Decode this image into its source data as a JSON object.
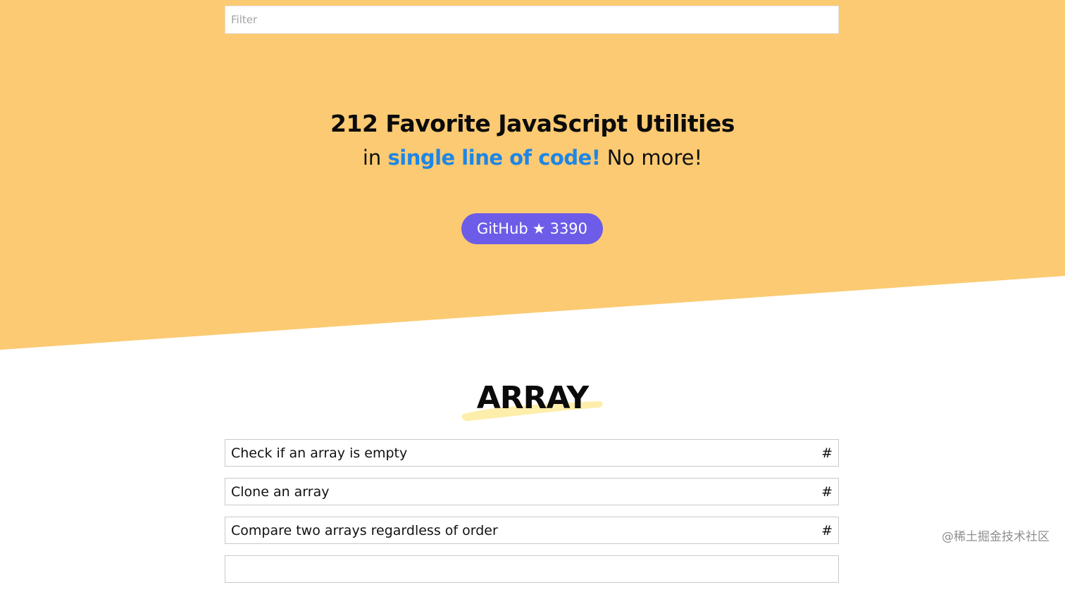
{
  "filter": {
    "placeholder": "Filter",
    "value": ""
  },
  "hero": {
    "title": "212 Favorite JavaScript Utilities",
    "subtitle_prefix": "in ",
    "subtitle_highlight": "single line of code!",
    "subtitle_suffix": " No more!",
    "highlight_color": "#1e86e5",
    "background_color": "#fcca72"
  },
  "github": {
    "label": "GitHub",
    "star_icon": "★",
    "star_count": "3390",
    "color": "#6c5ce7"
  },
  "section": {
    "title": "ARRAY",
    "brush_color": "#fdeeab",
    "items": [
      {
        "title": "Check if an array is empty",
        "anchor": "#"
      },
      {
        "title": "Clone an array",
        "anchor": "#"
      },
      {
        "title": "Compare two arrays regardless of order",
        "anchor": "#"
      },
      {
        "title": "",
        "anchor": ""
      }
    ]
  },
  "watermark": {
    "text": "@稀土掘金技术社区"
  }
}
